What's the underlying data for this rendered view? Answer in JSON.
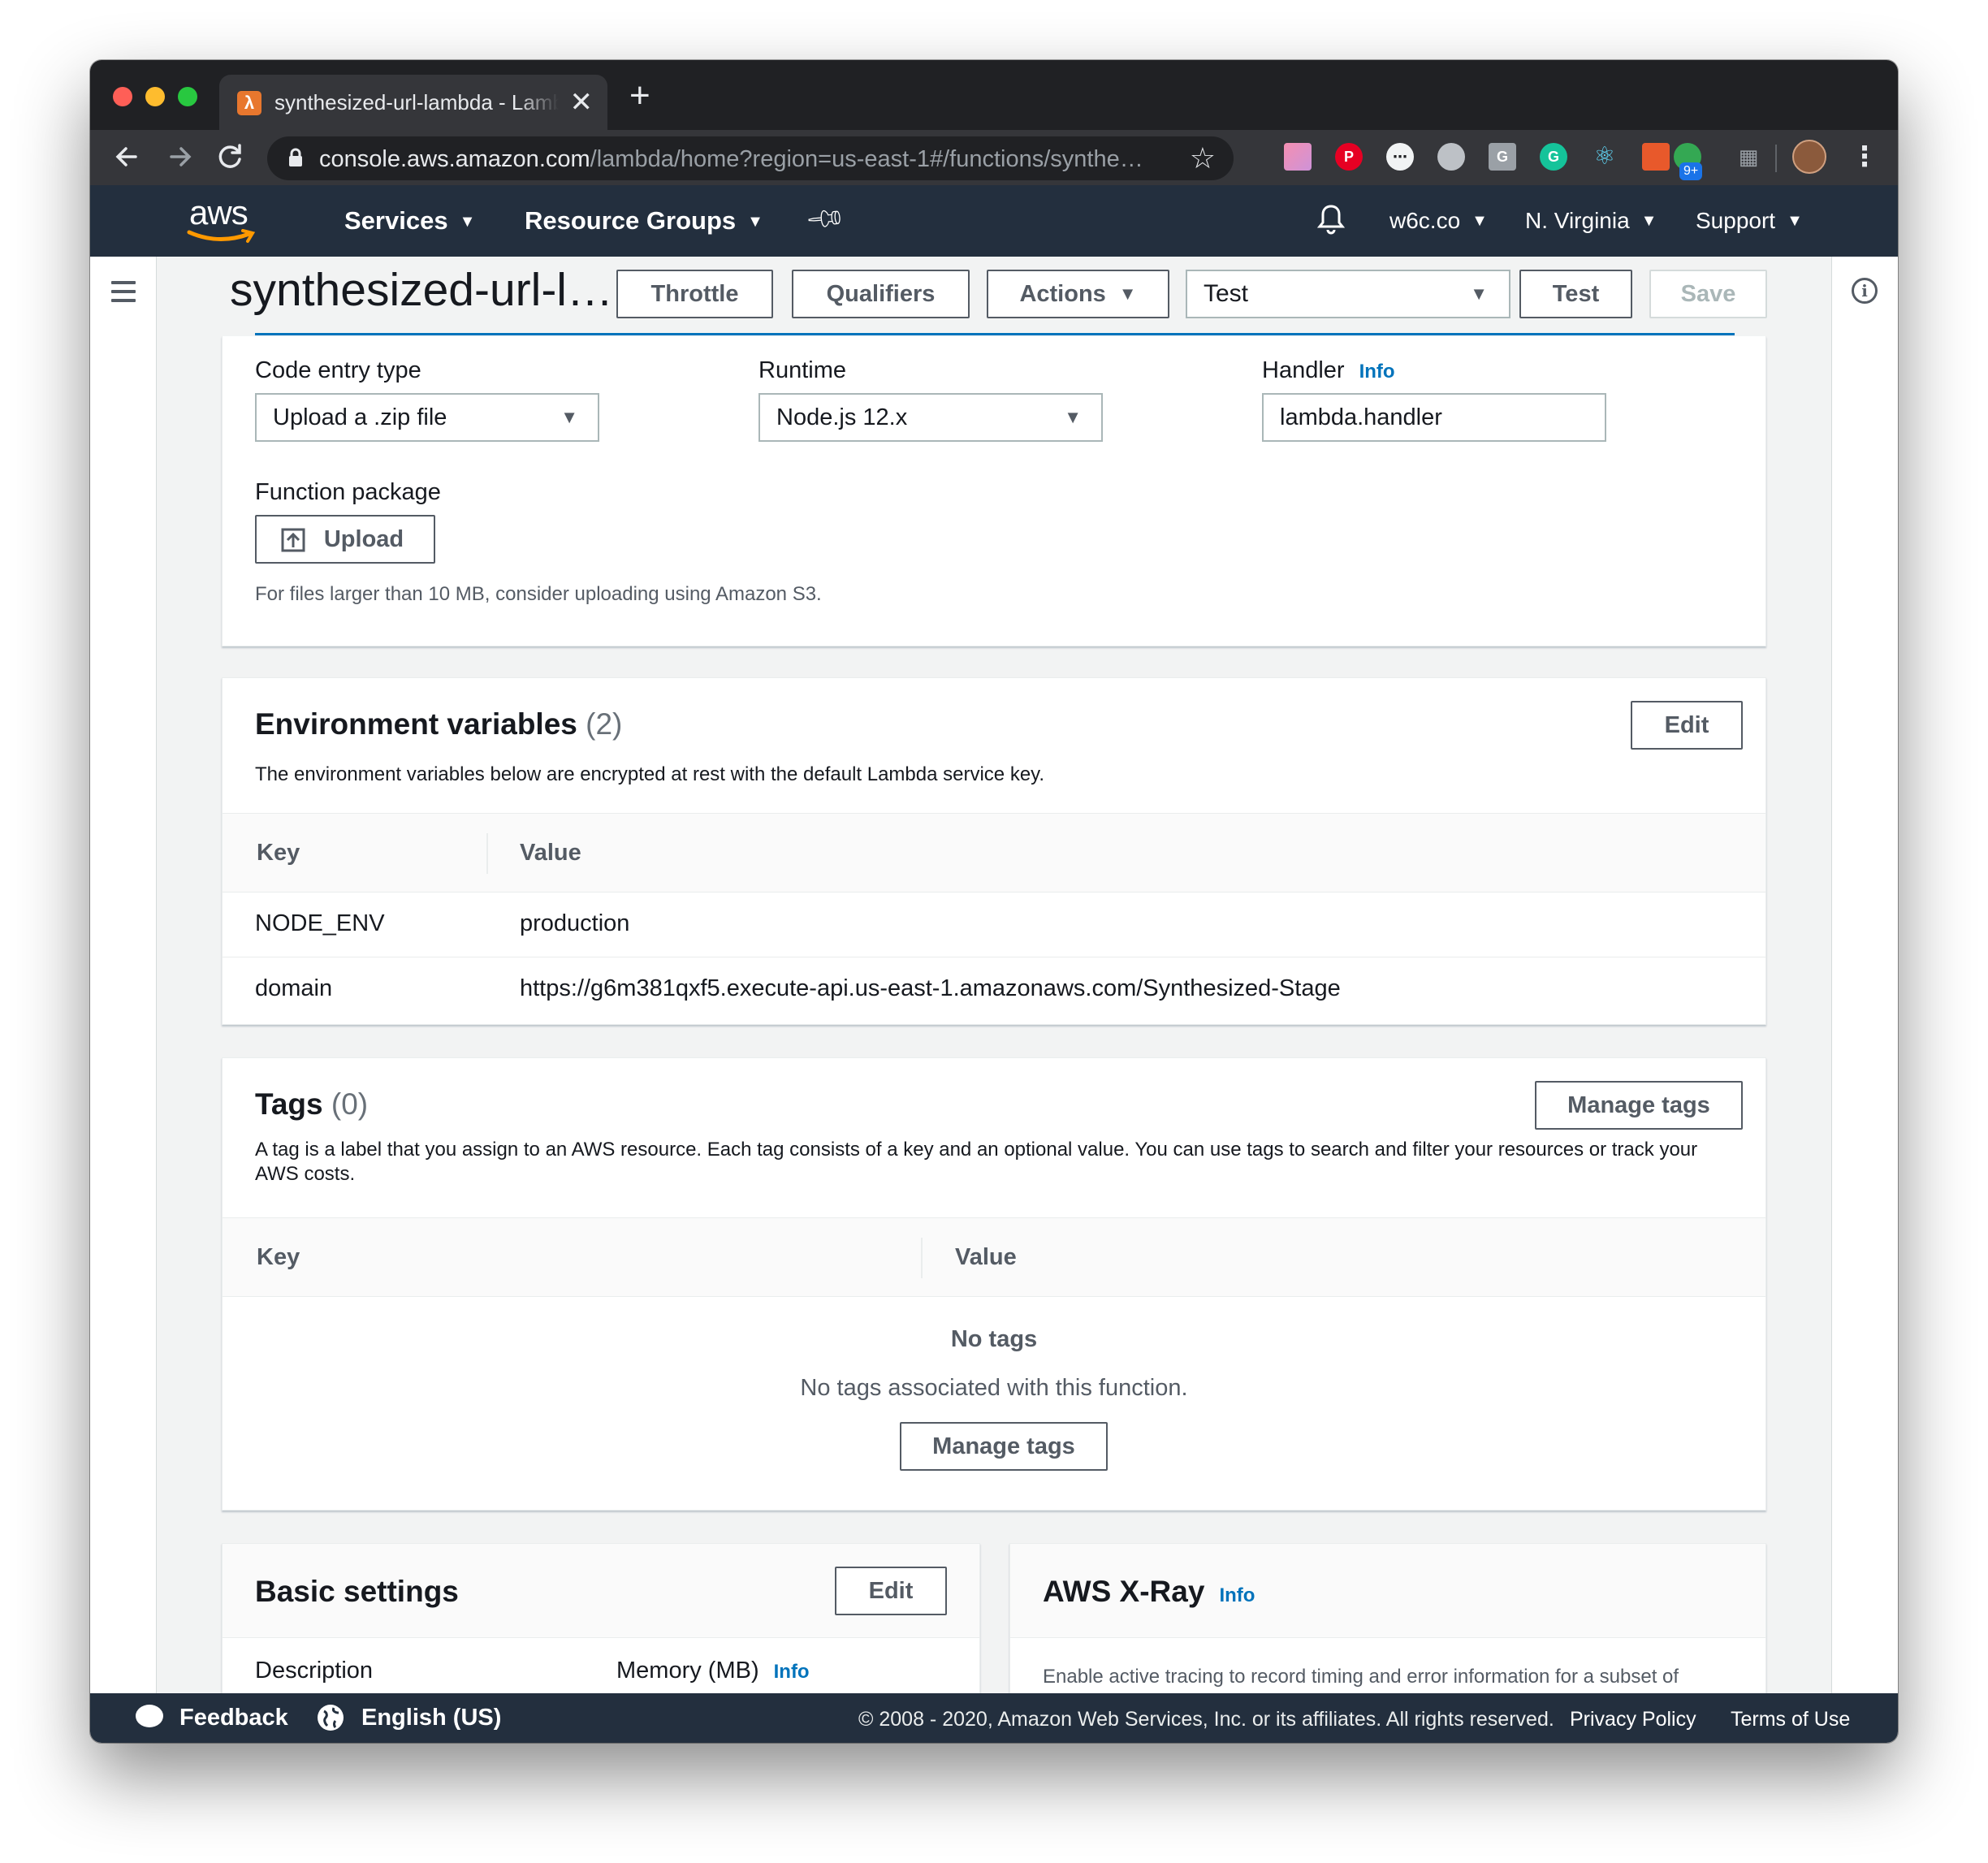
{
  "browser": {
    "tab_title": "synthesized-url-lambda - Lambda",
    "tab_close": "✕",
    "new_tab": "+",
    "url_host": "console.aws.amazon.com",
    "url_path": "/lambda/home?region=us-east-1#/functions/synthe…",
    "extension_badge": "9+"
  },
  "awsnav": {
    "logo": "aws",
    "services": "Services",
    "resource_groups": "Resource Groups",
    "account": "w6c.co",
    "region": "N. Virginia",
    "support": "Support"
  },
  "header": {
    "function_name": "synthesized-url-lambda",
    "throttle": "Throttle",
    "qualifiers": "Qualifiers",
    "actions": "Actions",
    "test_event_select": "Test",
    "test_button": "Test",
    "save_button": "Save"
  },
  "code": {
    "code_entry_label": "Code entry type",
    "code_entry_value": "Upload a .zip file",
    "runtime_label": "Runtime",
    "runtime_value": "Node.js 12.x",
    "handler_label": "Handler",
    "handler_info": "Info",
    "handler_value": "lambda.handler",
    "package_label": "Function package",
    "upload_button": "Upload",
    "upload_hint": "For files larger than 10 MB, consider uploading using Amazon S3."
  },
  "env": {
    "title": "Environment variables",
    "count": "(2)",
    "edit": "Edit",
    "description": "The environment variables below are encrypted at rest with the default Lambda service key.",
    "col_key": "Key",
    "col_value": "Value",
    "rows": [
      {
        "key": "NODE_ENV",
        "value": "production"
      },
      {
        "key": "domain",
        "value": "https://g6m381qxf5.execute-api.us-east-1.amazonaws.com/Synthesized-Stage"
      }
    ]
  },
  "tags": {
    "title": "Tags",
    "count": "(0)",
    "manage": "Manage tags",
    "description": "A tag is a label that you assign to an AWS resource. Each tag consists of a key and an optional value. You can use tags to search and filter your resources or track your AWS costs.",
    "col_key": "Key",
    "col_value": "Value",
    "empty_title": "No tags",
    "empty_text": "No tags associated with this function.",
    "empty_button": "Manage tags"
  },
  "basic": {
    "title": "Basic settings",
    "edit": "Edit",
    "description_label": "Description",
    "memory_label": "Memory (MB)",
    "memory_info": "Info"
  },
  "xray": {
    "title": "AWS X-Ray",
    "info": "Info",
    "text": "Enable active tracing to record timing and error information for a subset of"
  },
  "footer": {
    "feedback": "Feedback",
    "language": "English (US)",
    "copyright": "© 2008 - 2020, Amazon Web Services, Inc. or its affiliates. All rights reserved.",
    "privacy": "Privacy Policy",
    "terms": "Terms of Use"
  },
  "colors": {
    "aws_nav": "#232f3e",
    "aws_orange": "#ff9900",
    "link_blue": "#0073bb",
    "chrome_dark": "#202124"
  }
}
